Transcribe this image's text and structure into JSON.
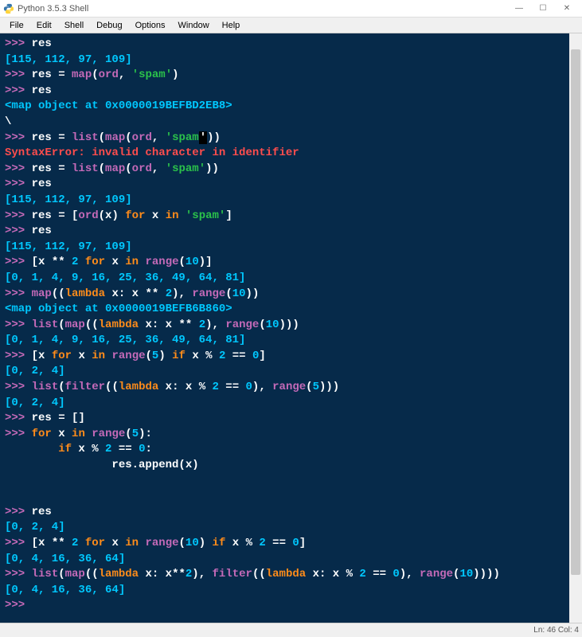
{
  "window": {
    "title": "Python 3.5.3 Shell",
    "minimize_icon": "—",
    "maximize_icon": "☐",
    "close_icon": "✕"
  },
  "menu": [
    "File",
    "Edit",
    "Shell",
    "Debug",
    "Options",
    "Window",
    "Help"
  ],
  "status": {
    "text": "Ln: 46   Col: 4"
  },
  "shell": {
    "prompt": ">>> ",
    "lines": [
      {
        "type": "in",
        "segs": [
          {
            "c": "txt",
            "t": "res"
          }
        ]
      },
      {
        "type": "out",
        "text": "[115, 112, 97, 109]"
      },
      {
        "type": "in",
        "segs": [
          {
            "c": "txt",
            "t": "res = "
          },
          {
            "c": "fn",
            "t": "map"
          },
          {
            "c": "txt",
            "t": "("
          },
          {
            "c": "fn",
            "t": "ord"
          },
          {
            "c": "txt",
            "t": ", "
          },
          {
            "c": "str",
            "t": "'spam'"
          },
          {
            "c": "txt",
            "t": ")"
          }
        ]
      },
      {
        "type": "in",
        "segs": [
          {
            "c": "txt",
            "t": "res"
          }
        ]
      },
      {
        "type": "out",
        "text": "<map object at 0x0000019BEFBD2EB8>"
      },
      {
        "type": "raw",
        "text": "\\"
      },
      {
        "type": "in",
        "segs": [
          {
            "c": "txt",
            "t": "res = "
          },
          {
            "c": "fn",
            "t": "list"
          },
          {
            "c": "txt",
            "t": "("
          },
          {
            "c": "fn",
            "t": "map"
          },
          {
            "c": "txt",
            "t": "("
          },
          {
            "c": "fn",
            "t": "ord"
          },
          {
            "c": "txt",
            "t": ", "
          },
          {
            "c": "str",
            "t": "'spam"
          },
          {
            "c": "cursor-mark",
            "t": "'"
          },
          {
            "c": "txt",
            "t": "))"
          }
        ]
      },
      {
        "type": "err",
        "text": "SyntaxError: invalid character in identifier"
      },
      {
        "type": "in",
        "segs": [
          {
            "c": "txt",
            "t": "res = "
          },
          {
            "c": "fn",
            "t": "list"
          },
          {
            "c": "txt",
            "t": "("
          },
          {
            "c": "fn",
            "t": "map"
          },
          {
            "c": "txt",
            "t": "("
          },
          {
            "c": "fn",
            "t": "ord"
          },
          {
            "c": "txt",
            "t": ", "
          },
          {
            "c": "str",
            "t": "'spam'"
          },
          {
            "c": "txt",
            "t": "))"
          }
        ]
      },
      {
        "type": "in",
        "segs": [
          {
            "c": "txt",
            "t": "res"
          }
        ]
      },
      {
        "type": "out",
        "text": "[115, 112, 97, 109]"
      },
      {
        "type": "in",
        "segs": [
          {
            "c": "txt",
            "t": "res = ["
          },
          {
            "c": "fn",
            "t": "ord"
          },
          {
            "c": "txt",
            "t": "(x) "
          },
          {
            "c": "kw",
            "t": "for"
          },
          {
            "c": "txt",
            "t": " x "
          },
          {
            "c": "kw",
            "t": "in"
          },
          {
            "c": "txt",
            "t": " "
          },
          {
            "c": "str",
            "t": "'spam'"
          },
          {
            "c": "txt",
            "t": "]"
          }
        ]
      },
      {
        "type": "in",
        "segs": [
          {
            "c": "txt",
            "t": "res"
          }
        ]
      },
      {
        "type": "out",
        "text": "[115, 112, 97, 109]"
      },
      {
        "type": "in",
        "segs": [
          {
            "c": "txt",
            "t": "[x ** "
          },
          {
            "c": "num",
            "t": "2"
          },
          {
            "c": "txt",
            "t": " "
          },
          {
            "c": "kw",
            "t": "for"
          },
          {
            "c": "txt",
            "t": " x "
          },
          {
            "c": "kw",
            "t": "in"
          },
          {
            "c": "txt",
            "t": " "
          },
          {
            "c": "fn",
            "t": "range"
          },
          {
            "c": "txt",
            "t": "("
          },
          {
            "c": "num",
            "t": "10"
          },
          {
            "c": "txt",
            "t": ")]"
          }
        ]
      },
      {
        "type": "out",
        "text": "[0, 1, 4, 9, 16, 25, 36, 49, 64, 81]"
      },
      {
        "type": "in",
        "segs": [
          {
            "c": "fn",
            "t": "map"
          },
          {
            "c": "txt",
            "t": "(("
          },
          {
            "c": "kw",
            "t": "lambda"
          },
          {
            "c": "txt",
            "t": " x: x ** "
          },
          {
            "c": "num",
            "t": "2"
          },
          {
            "c": "txt",
            "t": "), "
          },
          {
            "c": "fn",
            "t": "range"
          },
          {
            "c": "txt",
            "t": "("
          },
          {
            "c": "num",
            "t": "10"
          },
          {
            "c": "txt",
            "t": "))"
          }
        ]
      },
      {
        "type": "out",
        "text": "<map object at 0x0000019BEFB6B860>"
      },
      {
        "type": "in",
        "segs": [
          {
            "c": "fn",
            "t": "list"
          },
          {
            "c": "txt",
            "t": "("
          },
          {
            "c": "fn",
            "t": "map"
          },
          {
            "c": "txt",
            "t": "(("
          },
          {
            "c": "kw",
            "t": "lambda"
          },
          {
            "c": "txt",
            "t": " x: x ** "
          },
          {
            "c": "num",
            "t": "2"
          },
          {
            "c": "txt",
            "t": "), "
          },
          {
            "c": "fn",
            "t": "range"
          },
          {
            "c": "txt",
            "t": "("
          },
          {
            "c": "num",
            "t": "10"
          },
          {
            "c": "txt",
            "t": ")))"
          }
        ]
      },
      {
        "type": "out",
        "text": "[0, 1, 4, 9, 16, 25, 36, 49, 64, 81]"
      },
      {
        "type": "in",
        "segs": [
          {
            "c": "txt",
            "t": "[x "
          },
          {
            "c": "kw",
            "t": "for"
          },
          {
            "c": "txt",
            "t": " x "
          },
          {
            "c": "kw",
            "t": "in"
          },
          {
            "c": "txt",
            "t": " "
          },
          {
            "c": "fn",
            "t": "range"
          },
          {
            "c": "txt",
            "t": "("
          },
          {
            "c": "num",
            "t": "5"
          },
          {
            "c": "txt",
            "t": ") "
          },
          {
            "c": "kw",
            "t": "if"
          },
          {
            "c": "txt",
            "t": " x % "
          },
          {
            "c": "num",
            "t": "2"
          },
          {
            "c": "txt",
            "t": " == "
          },
          {
            "c": "num",
            "t": "0"
          },
          {
            "c": "txt",
            "t": "]"
          }
        ]
      },
      {
        "type": "out",
        "text": "[0, 2, 4]"
      },
      {
        "type": "in",
        "segs": [
          {
            "c": "fn",
            "t": "list"
          },
          {
            "c": "txt",
            "t": "("
          },
          {
            "c": "fn",
            "t": "filter"
          },
          {
            "c": "txt",
            "t": "(("
          },
          {
            "c": "kw",
            "t": "lambda"
          },
          {
            "c": "txt",
            "t": " x: x % "
          },
          {
            "c": "num",
            "t": "2"
          },
          {
            "c": "txt",
            "t": " == "
          },
          {
            "c": "num",
            "t": "0"
          },
          {
            "c": "txt",
            "t": "), "
          },
          {
            "c": "fn",
            "t": "range"
          },
          {
            "c": "txt",
            "t": "("
          },
          {
            "c": "num",
            "t": "5"
          },
          {
            "c": "txt",
            "t": ")))"
          }
        ]
      },
      {
        "type": "out",
        "text": "[0, 2, 4]"
      },
      {
        "type": "in",
        "segs": [
          {
            "c": "txt",
            "t": "res = []"
          }
        ]
      },
      {
        "type": "in",
        "segs": [
          {
            "c": "kw",
            "t": "for"
          },
          {
            "c": "txt",
            "t": " x "
          },
          {
            "c": "kw",
            "t": "in"
          },
          {
            "c": "txt",
            "t": " "
          },
          {
            "c": "fn",
            "t": "range"
          },
          {
            "c": "txt",
            "t": "("
          },
          {
            "c": "num",
            "t": "5"
          },
          {
            "c": "txt",
            "t": "):"
          }
        ]
      },
      {
        "type": "cont",
        "segs": [
          {
            "c": "txt",
            "t": "        "
          },
          {
            "c": "kw",
            "t": "if"
          },
          {
            "c": "txt",
            "t": " x % "
          },
          {
            "c": "num",
            "t": "2"
          },
          {
            "c": "txt",
            "t": " == "
          },
          {
            "c": "num",
            "t": "0"
          },
          {
            "c": "txt",
            "t": ":"
          }
        ]
      },
      {
        "type": "cont",
        "segs": [
          {
            "c": "txt",
            "t": "                res.append(x)"
          }
        ]
      },
      {
        "type": "blank",
        "text": ""
      },
      {
        "type": "blank",
        "text": ""
      },
      {
        "type": "in",
        "segs": [
          {
            "c": "txt",
            "t": "res"
          }
        ]
      },
      {
        "type": "out",
        "text": "[0, 2, 4]"
      },
      {
        "type": "in",
        "segs": [
          {
            "c": "txt",
            "t": "[x ** "
          },
          {
            "c": "num",
            "t": "2"
          },
          {
            "c": "txt",
            "t": " "
          },
          {
            "c": "kw",
            "t": "for"
          },
          {
            "c": "txt",
            "t": " x "
          },
          {
            "c": "kw",
            "t": "in"
          },
          {
            "c": "txt",
            "t": " "
          },
          {
            "c": "fn",
            "t": "range"
          },
          {
            "c": "txt",
            "t": "("
          },
          {
            "c": "num",
            "t": "10"
          },
          {
            "c": "txt",
            "t": ") "
          },
          {
            "c": "kw",
            "t": "if"
          },
          {
            "c": "txt",
            "t": " x % "
          },
          {
            "c": "num",
            "t": "2"
          },
          {
            "c": "txt",
            "t": " == "
          },
          {
            "c": "num",
            "t": "0"
          },
          {
            "c": "txt",
            "t": "]"
          }
        ]
      },
      {
        "type": "out",
        "text": "[0, 4, 16, 36, 64]"
      },
      {
        "type": "in",
        "segs": [
          {
            "c": "fn",
            "t": "list"
          },
          {
            "c": "txt",
            "t": "("
          },
          {
            "c": "fn",
            "t": "map"
          },
          {
            "c": "txt",
            "t": "(("
          },
          {
            "c": "kw",
            "t": "lambda"
          },
          {
            "c": "txt",
            "t": " x: x**"
          },
          {
            "c": "num",
            "t": "2"
          },
          {
            "c": "txt",
            "t": "), "
          },
          {
            "c": "fn",
            "t": "filter"
          },
          {
            "c": "txt",
            "t": "(("
          },
          {
            "c": "kw",
            "t": "lambda"
          },
          {
            "c": "txt",
            "t": " x: x % "
          },
          {
            "c": "num",
            "t": "2"
          },
          {
            "c": "txt",
            "t": " == "
          },
          {
            "c": "num",
            "t": "0"
          },
          {
            "c": "txt",
            "t": "), "
          },
          {
            "c": "fn",
            "t": "range"
          },
          {
            "c": "txt",
            "t": "("
          },
          {
            "c": "num",
            "t": "10"
          },
          {
            "c": "txt",
            "t": "))))"
          }
        ]
      },
      {
        "type": "out",
        "text": "[0, 4, 16, 36, 64]"
      },
      {
        "type": "in",
        "segs": []
      }
    ]
  }
}
